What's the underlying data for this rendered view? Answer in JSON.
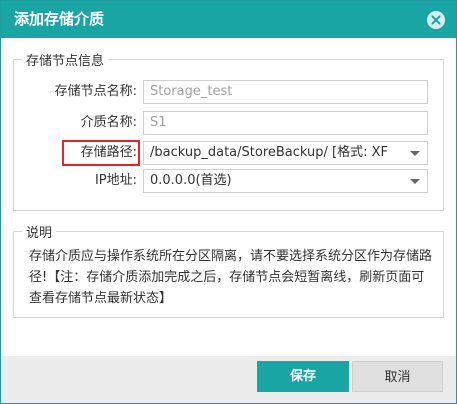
{
  "dialog": {
    "title": "添加存储介质",
    "close_icon": "close-icon"
  },
  "storage_info": {
    "legend": "存储节点信息",
    "node_name_label": "存储节点名称:",
    "node_name_value": "Storage_test",
    "medium_name_label": "介质名称:",
    "medium_name_value": "S1",
    "path_label": "存储路径:",
    "path_value": "/backup_data/StoreBackup/ [格式: XF",
    "ip_label": "IP地址:",
    "ip_value": "0.0.0.0(首选)"
  },
  "description": {
    "legend": "说明",
    "text": "存储介质应与操作系统所在分区隔离，请不要选择系统分区作为存储路径!【注：存储介质添加完成之后，存储节点会短暂离线，刷新页面可查看存储节点最新状态】"
  },
  "footer": {
    "save_label": "保存",
    "cancel_label": "取消"
  },
  "colors": {
    "accent": "#19a5a3",
    "highlight": "#e3262e"
  }
}
